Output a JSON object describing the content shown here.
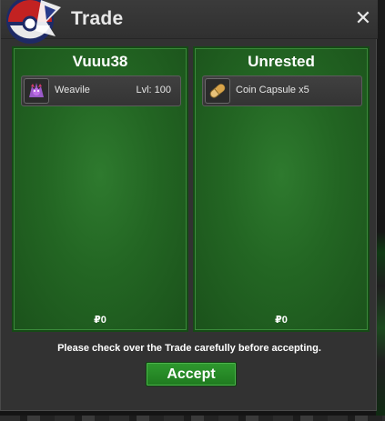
{
  "window": {
    "title": "Trade",
    "close_label": "✕"
  },
  "left_panel": {
    "name": "Vuuu38",
    "item": {
      "name": "Weavile",
      "extra": "Lvl: 100",
      "icon": "weavile-sprite-icon"
    },
    "money": "₽0"
  },
  "right_panel": {
    "name": "Unrested",
    "item": {
      "name": "Coin Capsule  x5",
      "icon": "coin-capsule-icon"
    },
    "money": "₽0"
  },
  "notice": "Please check over the Trade carefully before accepting.",
  "accept_label": "Accept",
  "colors": {
    "panel_green": "#236623",
    "button_green": "#2a8f2a",
    "window_bg": "#323232"
  }
}
